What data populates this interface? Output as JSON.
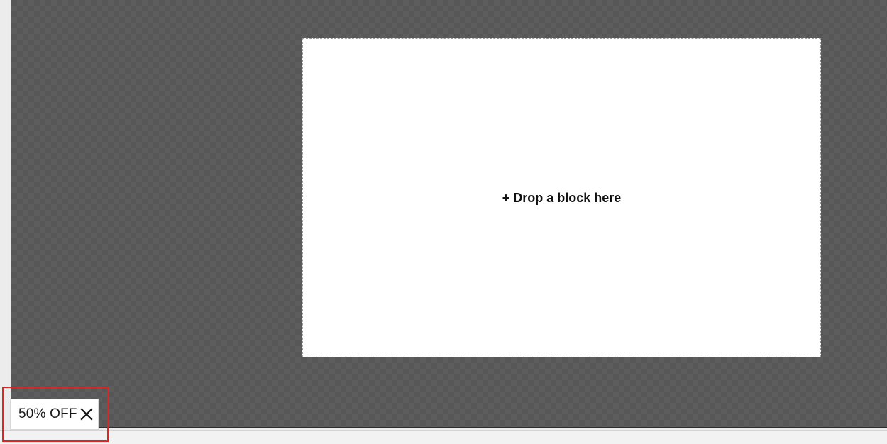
{
  "canvas": {
    "drop_zone": {
      "label": "+ Drop a block here"
    }
  },
  "promo": {
    "text": "50% OFF",
    "close_icon": "close-icon"
  },
  "colors": {
    "canvas_bg": "#575757",
    "drop_zone_bg": "#ffffff",
    "highlight": "#e02424"
  }
}
